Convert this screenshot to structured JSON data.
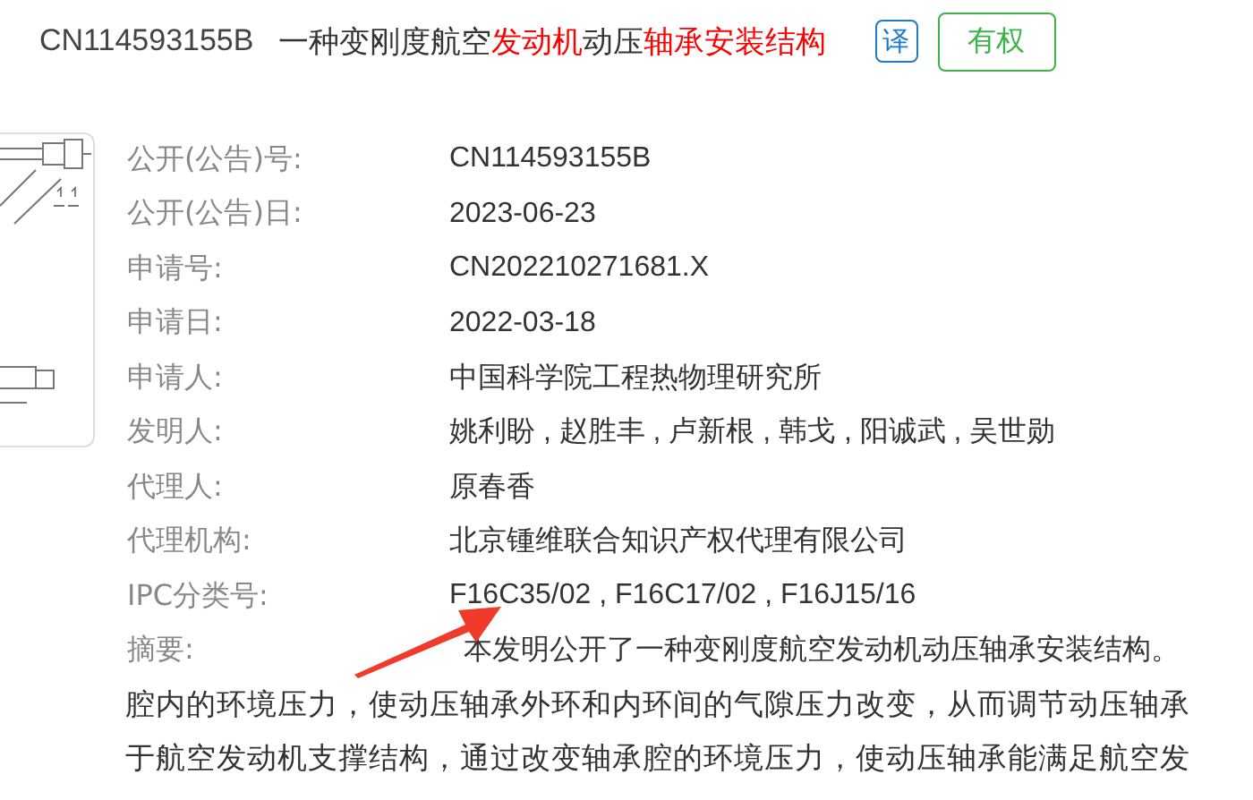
{
  "header": {
    "number": "CN114593155B",
    "title": [
      {
        "text": "一种变刚度航空",
        "highlight": false
      },
      {
        "text": "发动机",
        "highlight": true
      },
      {
        "text": "动压",
        "highlight": false
      },
      {
        "text": "轴承安装结构",
        "highlight": true
      }
    ],
    "translate": "译",
    "status": "有权"
  },
  "fields": [
    {
      "label": "公开(公告)号:",
      "value": "CN114593155B"
    },
    {
      "label": "公开(公告)日:",
      "value": "2023-06-23"
    },
    {
      "label": "申请号:",
      "value": "CN202210271681.X"
    },
    {
      "label": "申请日:",
      "value": "2022-03-18"
    },
    {
      "label": "申请人:",
      "value": "中国科学院工程热物理研究所"
    },
    {
      "label": "发明人:",
      "value": "姚利盼 , 赵胜丰 , 卢新根 , 韩戈 , 阳诚武 , 吴世勋"
    },
    {
      "label": "代理人:",
      "value": "原春香"
    },
    {
      "label": "代理机构:",
      "value": "北京锺维联合知识产权代理有限公司"
    },
    {
      "label": "IPC分类号:",
      "value": "F16C35/02 , F16C17/02 , F16J15/16"
    }
  ],
  "abstract": {
    "label": "摘要:",
    "lines": [
      "本发明公开了一种变刚度航空发动机动压轴承安装结构。",
      "腔内的环境压力，使动压轴承外环和内环间的气隙压力改变，从而调节动压轴承",
      "于航空发动机支撑结构，通过改变轴承腔的环境压力，使动压轴承能满足航空发"
    ]
  }
}
